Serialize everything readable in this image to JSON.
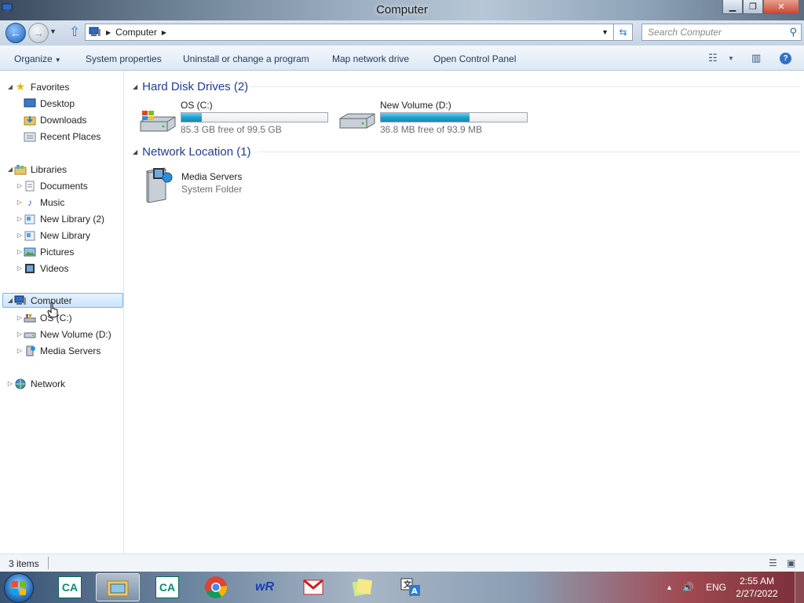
{
  "window": {
    "title": "Computer",
    "buttons": {
      "minimize": "▁",
      "maximize": "❐",
      "close": "✕"
    }
  },
  "address": {
    "crumbs": [
      "Computer"
    ],
    "search_placeholder": "Search Computer"
  },
  "commands": {
    "organize": "Organize",
    "system_properties": "System properties",
    "uninstall": "Uninstall or change a program",
    "map_drive": "Map network drive",
    "control_panel": "Open Control Panel"
  },
  "navpane": {
    "favorites": {
      "label": "Favorites",
      "items": [
        "Desktop",
        "Downloads",
        "Recent Places"
      ]
    },
    "libraries": {
      "label": "Libraries",
      "items": [
        "Documents",
        "Music",
        "New Library (2)",
        "New Library",
        "Pictures",
        "Videos"
      ]
    },
    "computer": {
      "label": "Computer",
      "items": [
        "OS (C:)",
        "New Volume (D:)",
        "Media Servers"
      ]
    },
    "network": {
      "label": "Network"
    }
  },
  "content": {
    "hdd_group": "Hard Disk Drives (2)",
    "drives": [
      {
        "name": "OS (C:)",
        "free_text": "85.3 GB free of 99.5 GB",
        "used_fraction": 0.14
      },
      {
        "name": "New Volume (D:)",
        "free_text": "36.8 MB free of 93.9 MB",
        "used_fraction": 0.61
      }
    ],
    "net_group": "Network Location (1)",
    "netloc": {
      "name": "Media Servers",
      "type": "System Folder"
    }
  },
  "status": {
    "count": "3 items"
  },
  "tray": {
    "lang": "ENG",
    "time": "2:55 AM",
    "date": "2/27/2022"
  },
  "taskbar": {
    "apps": [
      "credit-agricole",
      "explorer",
      "credit-agricole",
      "chrome",
      "wr",
      "gmail",
      "notes",
      "translate"
    ]
  },
  "colors": {
    "accent": "#1e3d8a",
    "bar_fill": "#1d9ac7",
    "selection": "#cbe3fb"
  }
}
